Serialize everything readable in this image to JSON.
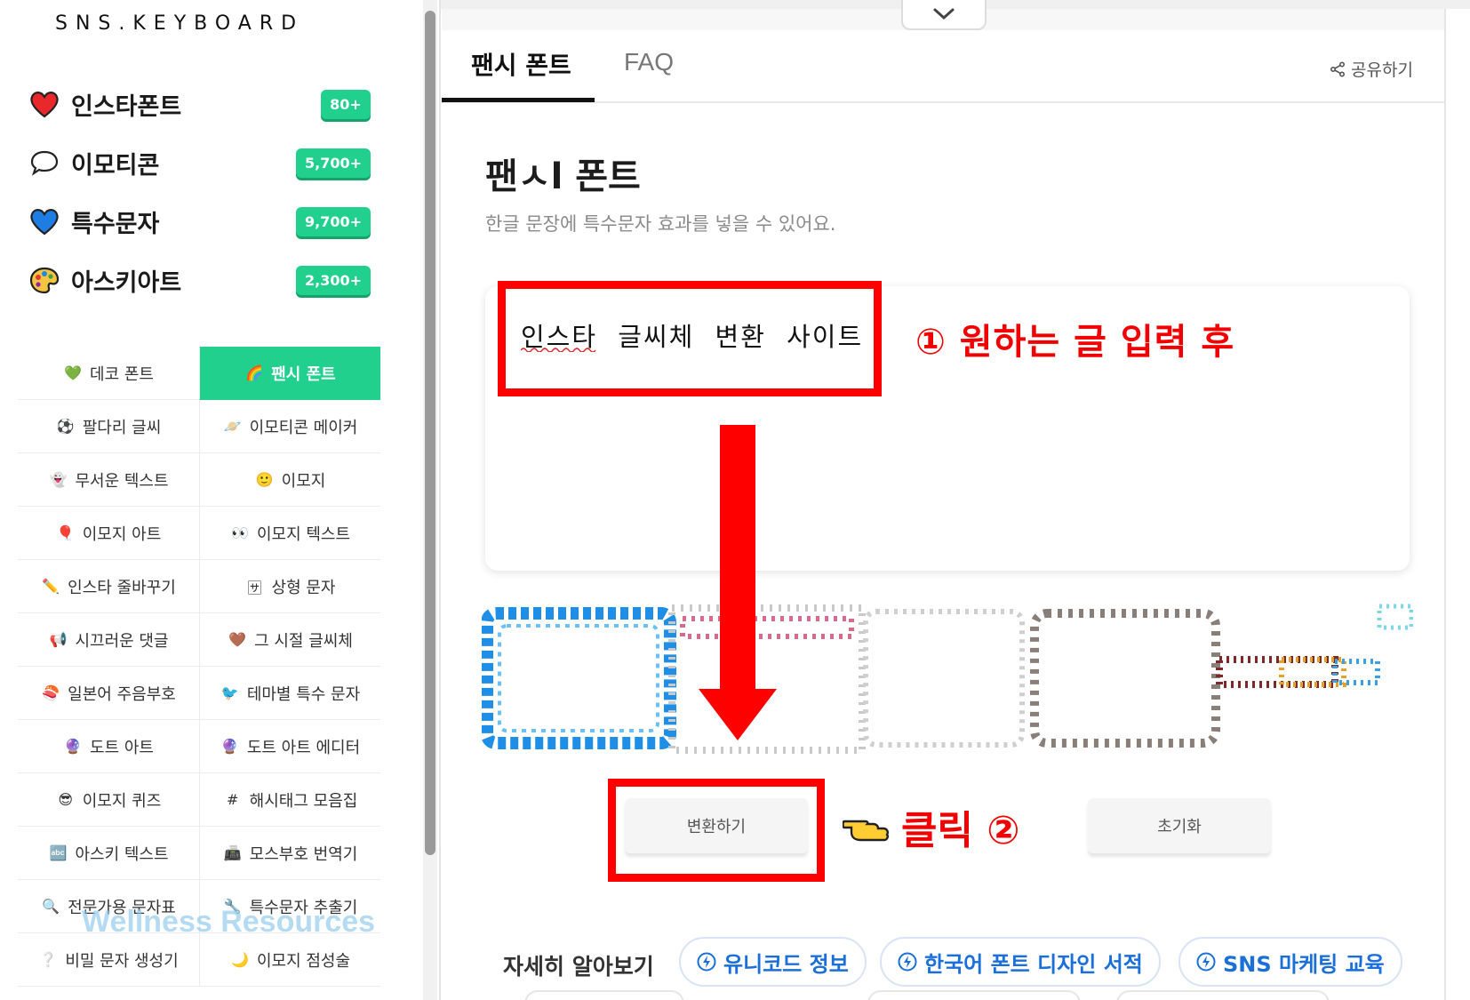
{
  "app": {
    "logo": "SNS.KEYBOARD"
  },
  "sidebar": {
    "categories": [
      {
        "label": "인스타폰트",
        "badge": "80+",
        "icon": "heart-red-icon"
      },
      {
        "label": "이모티콘",
        "badge": "5,700+",
        "icon": "speech-bubble-icon"
      },
      {
        "label": "특수문자",
        "badge": "9,700+",
        "icon": "heart-blue-icon"
      },
      {
        "label": "아스키아트",
        "badge": "2,300+",
        "icon": "palette-icon"
      }
    ],
    "menu": [
      {
        "label": "데코 폰트",
        "icon": "💚"
      },
      {
        "label": "팬시 폰트",
        "icon": "🌈"
      },
      {
        "label": "팔다리 글씨",
        "icon": "⚽"
      },
      {
        "label": "이모티콘 메이커",
        "icon": "🪐"
      },
      {
        "label": "무서운 텍스트",
        "icon": "👻"
      },
      {
        "label": "이모지",
        "icon": "🙂"
      },
      {
        "label": "이모지 아트",
        "icon": "🎈"
      },
      {
        "label": "이모지 텍스트",
        "icon": "👀"
      },
      {
        "label": "인스타 줄바꾸기",
        "icon": "✏️"
      },
      {
        "label": "상형 문자",
        "icon": "🈂"
      },
      {
        "label": "시끄러운 댓글",
        "icon": "📢"
      },
      {
        "label": "그 시절 글씨체",
        "icon": "🤎"
      },
      {
        "label": "일본어 주음부호",
        "icon": "🍣"
      },
      {
        "label": "테마별 특수 문자",
        "icon": "🐦"
      },
      {
        "label": "도트 아트",
        "icon": "🔮"
      },
      {
        "label": "도트 아트 에디터",
        "icon": "🔮"
      },
      {
        "label": "이모지 퀴즈",
        "icon": "😎"
      },
      {
        "label": "해시태그 모음집",
        "icon": "#"
      },
      {
        "label": "아스키 텍스트",
        "icon": "🔤"
      },
      {
        "label": "모스부호 번역기",
        "icon": "📠"
      },
      {
        "label": "전문가용 문자표",
        "icon": "🔍"
      },
      {
        "label": "특수문자 추출기",
        "icon": "🔧"
      },
      {
        "label": "비밀 문자 생성기",
        "icon": "❔"
      },
      {
        "label": "이모지 점성술",
        "icon": "🌙"
      }
    ],
    "active_index": 1,
    "watermark": "Wellness Resources"
  },
  "tabs": [
    {
      "label": "팬시 폰트"
    },
    {
      "label": "FAQ"
    }
  ],
  "share_label": "공유하기",
  "page": {
    "title": "팬ㅅl 폰트",
    "subtitle": "한글 문장에 특수문자 효과를 넣을 수 있어요.",
    "input_value": "인스타 글씨체 변환 사이트"
  },
  "buttons": {
    "convert": "변환하기",
    "reset": "초기화"
  },
  "annotations": {
    "step1": "① 원하는 글 입력 후",
    "step2": "클릭 ②"
  },
  "more": {
    "label": "자세히 알아보기",
    "chips": [
      "유니코드 정보",
      "한국어 폰트 디자인 서적",
      "SNS 마케팅 교육"
    ]
  },
  "colors": {
    "accent": "#22d08e",
    "annotation_red": "#ff0000",
    "link_blue": "#1a6fd8"
  }
}
